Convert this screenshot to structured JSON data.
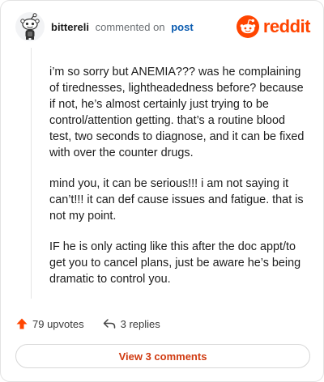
{
  "comment": {
    "username": "bittereli",
    "action_text": "commented on",
    "post_link": "post",
    "paragraphs": [
      "i’m so sorry but ANEMIA??? was he complaining of tirednesses, lightheadedness before? because if not, he’s almost certainly just trying to be control/attention getting. that’s a routine blood test, two seconds to diagnose, and it can be fixed with over the counter drugs.",
      "mind you, it can be serious!!! i am not saying it can’t!!! it can def cause issues and fatigue. that is not my point.",
      "IF he is only acting like this after the doc appt/to get you to cancel plans, just be aware he’s being dramatic to control you."
    ]
  },
  "brand": {
    "wordmark": "reddit",
    "color": "#ff4500",
    "icon": "reddit-snoo-icon"
  },
  "actions": {
    "upvotes": "79 upvotes",
    "replies": "3 replies",
    "upvote_icon": "upvote-arrow-icon",
    "reply_icon": "reply-arrow-icon",
    "upvote_color": "#ff4500"
  },
  "footer": {
    "view_comments": "View 3 comments",
    "accent": "#d03a10"
  }
}
